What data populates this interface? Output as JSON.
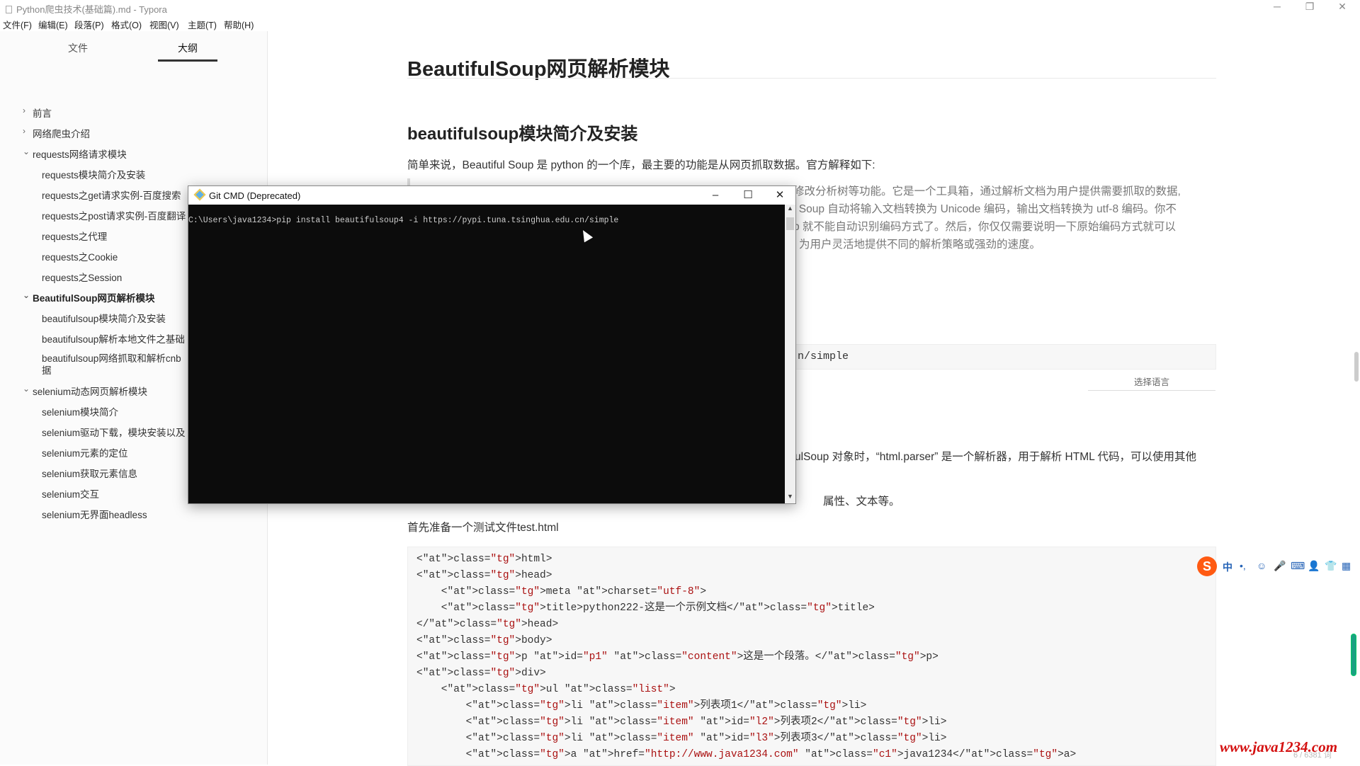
{
  "window": {
    "title": "Python爬虫技术(基础篇).md - Typora",
    "minimize": "─",
    "restore": "❐",
    "close": "✕"
  },
  "menu": [
    "文件(F)",
    "编辑(E)",
    "段落(P)",
    "格式(O)",
    "视图(V)",
    "主题(T)",
    "帮助(H)"
  ],
  "sidebar": {
    "tabs": [
      "文件",
      "大纲"
    ],
    "active_tab": "大纲",
    "items": [
      {
        "label": "前言",
        "chev": "›"
      },
      {
        "label": "网络爬虫介绍",
        "chev": "›"
      },
      {
        "label": "requests网络请求模块",
        "chev": "⌄"
      },
      {
        "label": "requests模块简介及安装"
      },
      {
        "label": "requests之get请求实例-百度搜索"
      },
      {
        "label": "requests之post请求实例-百度翻译"
      },
      {
        "label": "requests之代理"
      },
      {
        "label": "requests之Cookie"
      },
      {
        "label": "requests之Session"
      },
      {
        "label": "BeautifulSoup网页解析模块",
        "chev": "⌄"
      },
      {
        "label": "beautifulsoup模块简介及安装"
      },
      {
        "label": "beautifulsoup解析本地文件之基础"
      },
      {
        "label": "beautifulsoup网络抓取和解析cnb"
      },
      {
        "label": "据"
      },
      {
        "label": "selenium动态网页解析模块",
        "chev": "⌄"
      },
      {
        "label": "selenium模块简介"
      },
      {
        "label": "selenium驱动下载，模块安装以及"
      },
      {
        "label": "selenium元素的定位"
      },
      {
        "label": "selenium获取元素信息"
      },
      {
        "label": "selenium交互"
      },
      {
        "label": "selenium无界面headless"
      }
    ],
    "footer_left": "‹",
    "footer_code": "</>"
  },
  "doc": {
    "h1": "BeautifulSoup网页解析模块",
    "h2": "beautifulsoup模块简介及安装",
    "intro": "简单来说，Beautiful Soup 是 python 的一个库，最主要的功能是从网页抓取数据。官方解释如下:",
    "quote_lines": [
      "修改分析树等功能。它是一个工具箱，通过解析文档为用户提供需要抓取的数据,",
      "l Soup 自动将输入文档转换为 Unicode 编码，输出文档转换为 utf-8 编码。你不",
      "p 就不能自动识别编码方式了。然后，你仅仅需要说明一下原始编码方式就可以",
      "为用户灵活地提供不同的解析策略或强劲的速度。"
    ],
    "code_small": "n/simple",
    "lang_select": "选择语言",
    "para2": "ulSoup 对象时，“html.parser” 是一个解析器，用于解析 HTML 代码，可以使用其他",
    "para3": "属性、文本等。",
    "para4": "首先准备一个测试文件test.html",
    "code_lines": [
      "<html>",
      "<head>",
      "    <meta charset=\"utf-8\">",
      "    <title>python222-这是一个示例文档</title>",
      "</head>",
      "<body>",
      "<p id=\"p1\" class=\"content\">这是一个段落。</p>",
      "<div>",
      "    <ul class=\"list\">",
      "        <li class=\"item\">列表项1</li>",
      "        <li class=\"item\" id=\"l2\">列表项2</li>",
      "        <li class=\"item\" id=\"l3\">列表项3</li>",
      "        <a href=\"http://www.java1234.com\" class=\"c1\">java1234</a>"
    ],
    "word_count": "6 / 6381 词"
  },
  "cmd": {
    "title": "Git CMD (Deprecated)",
    "line": "C:\\Users\\java1234>pip install beautifulsoup4 -i https://pypi.tuna.tsinghua.edu.cn/simple"
  },
  "ime": {
    "logo": "S",
    "mode": "中",
    "punct": "•,",
    "icons": [
      "☺",
      "🎤",
      "⌨",
      "👤",
      "👕",
      "▦"
    ]
  },
  "watermark": "www.java1234.com"
}
